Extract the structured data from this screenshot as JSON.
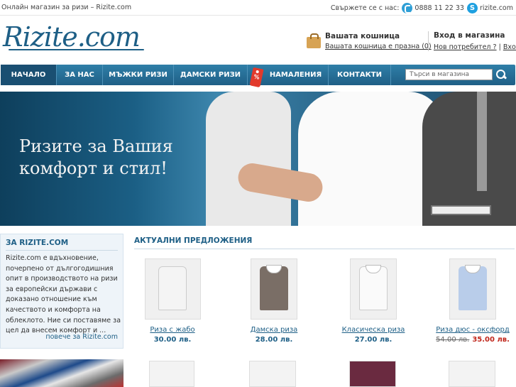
{
  "topbar": {
    "tagline": "Онлайн магазин за ризи – Rizite.com",
    "contact_label": "Свържете се с нас:",
    "phone": "0888 11 22 33",
    "skype": "rizite.com"
  },
  "header": {
    "logo_text": "Rizite.com",
    "cart_title": "Вашата кошница",
    "cart_status": "Вашата кошница е празна (0)",
    "login_title": "Вход в магазина",
    "new_user": "Нов потребител ?",
    "login_link": "Вход"
  },
  "nav": {
    "items": [
      "НАЧАЛО",
      "ЗА НАС",
      "МЪЖКИ РИЗИ",
      "ДАМСКИ РИЗИ",
      "НАМАЛЕНИЯ",
      "КОНТАКТИ"
    ],
    "sale_tag": "%",
    "search_placeholder": "Търси в магазина"
  },
  "banner": {
    "line1": "Ризите за Вашия",
    "line2": "комфорт и стил!"
  },
  "about": {
    "title": "ЗА RIZITE.COM",
    "text": "Rizite.com е вдъхновение, почерпено от дългогодишния опит в производството на ризи за европейски държави с доказано отношение към качеството и комфорта на облеклото. Ние си поставяме за цел да внесем комфорт и ...",
    "more": "повече за Rizite.com"
  },
  "offers": {
    "title": "АКТУАЛНИ ПРЕДЛОЖЕНИЯ",
    "products": [
      {
        "name": "Риза с жабо",
        "price": "30.00 лв.",
        "color": "#f4f4f4"
      },
      {
        "name": "Дамска риза",
        "price": "28.00 лв.",
        "color": "#7a6e66"
      },
      {
        "name": "Класическа риза",
        "price": "27.00 лв.",
        "color": "#fafafa"
      },
      {
        "name": "Риза дюс - оксфорд",
        "old_price": "54.00 лв.",
        "price": "35.00 лв.",
        "color": "#b9cdea"
      }
    ]
  },
  "colors": {
    "brand_blue": "#1e5f86",
    "nav_blue": "#2f7fa8",
    "sale_red": "#e23a2c",
    "price_red": "#c0261b"
  }
}
